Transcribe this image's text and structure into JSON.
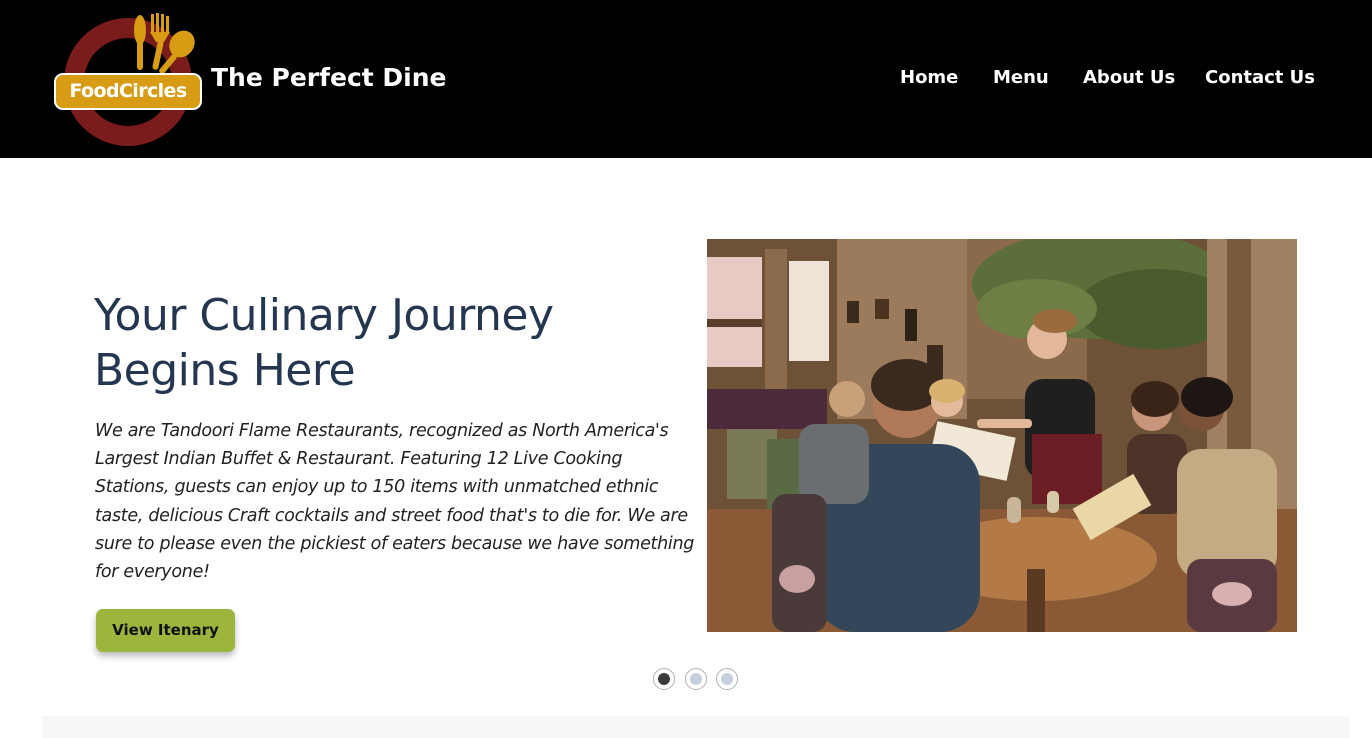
{
  "brand": {
    "logo_text": "FoodCircles",
    "site_title": "The Perfect Dine",
    "colors": {
      "header_bg": "#000000",
      "logo_gold": "#d89c14",
      "logo_ring": "#7a1c1c"
    }
  },
  "nav": {
    "items": [
      {
        "label": "Home"
      },
      {
        "label": "Menu"
      },
      {
        "label": "About Us"
      },
      {
        "label": "Contact Us"
      }
    ]
  },
  "hero": {
    "heading_line1": "Your Culinary Journey",
    "heading_line2": "Begins Here",
    "description": "We are Tandoori Flame Restaurants, recognized as North America's Largest Indian Buffet & Restaurant. Featuring 12 Live Cooking Stations, guests can enjoy up to 150 items with unmatched ethnic taste, delicious Craft cocktails and street food that's to die for. We are sure to please even the pickiest of eaters because we have something for everyone!",
    "button_label": "View Itenary",
    "button_color": "#9cb53c",
    "heading_color": "#243650"
  },
  "carousel": {
    "slide_count": 3,
    "active_index": 0
  }
}
